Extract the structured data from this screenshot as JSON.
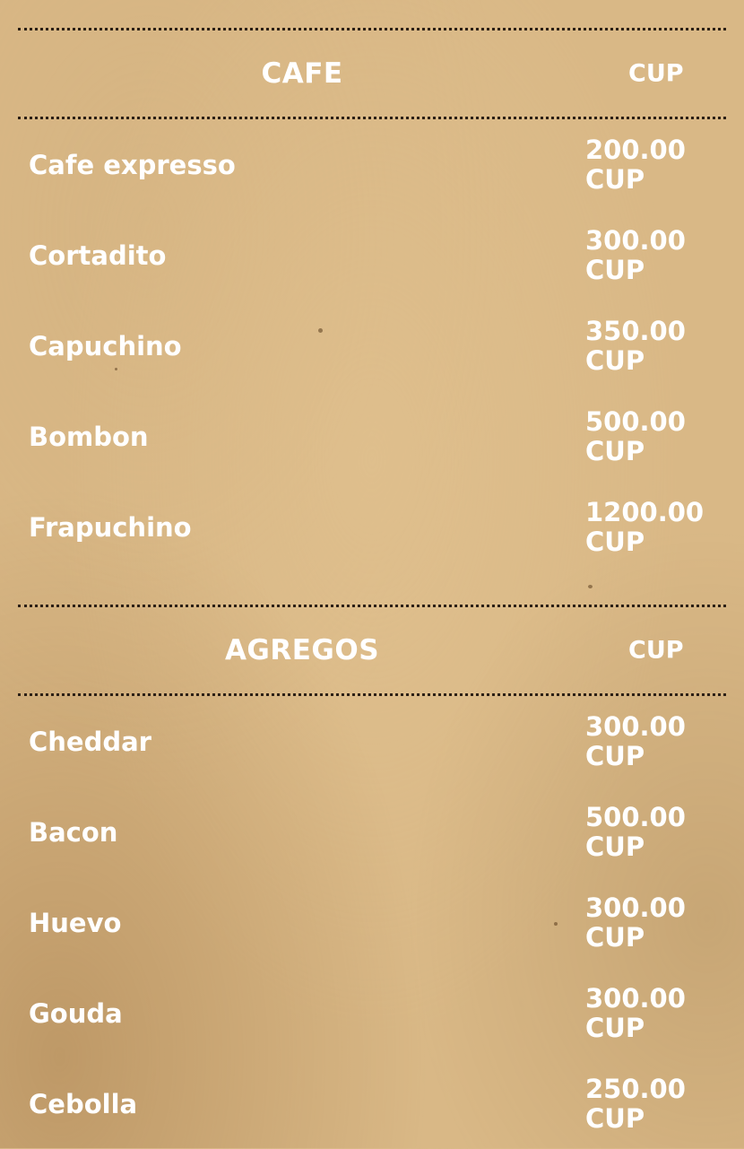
{
  "sections": [
    {
      "title": "CAFE",
      "currency": "CUP",
      "items": [
        {
          "name": "Cafe expresso",
          "price": "200.00",
          "currency": "CUP"
        },
        {
          "name": "Cortadito",
          "price": "300.00",
          "currency": "CUP"
        },
        {
          "name": "Capuchino",
          "price": "350.00",
          "currency": "CUP"
        },
        {
          "name": "Bombon",
          "price": "500.00",
          "currency": "CUP"
        },
        {
          "name": "Frapuchino",
          "price": "1200.00",
          "currency": "CUP"
        }
      ]
    },
    {
      "title": "AGREGOS",
      "currency": "CUP",
      "items": [
        {
          "name": "Cheddar",
          "price": "300.00",
          "currency": "CUP"
        },
        {
          "name": "Bacon",
          "price": "500.00",
          "currency": "CUP"
        },
        {
          "name": "Huevo",
          "price": "300.00",
          "currency": "CUP"
        },
        {
          "name": "Gouda",
          "price": "300.00",
          "currency": "CUP"
        },
        {
          "name": "Cebolla",
          "price": "250.00",
          "currency": "CUP"
        }
      ]
    }
  ],
  "colors": {
    "text": "#ffffff",
    "divider": "#2c2016",
    "background": "#d9b886"
  }
}
